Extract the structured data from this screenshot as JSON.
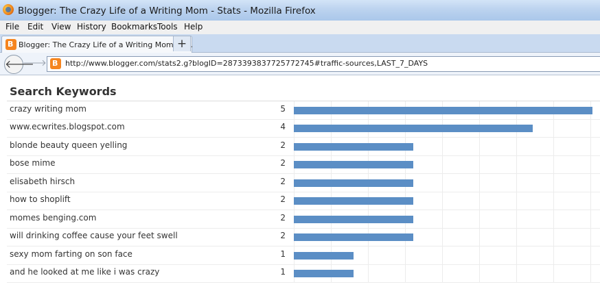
{
  "window": {
    "title": "Blogger: The Crazy Life of a Writing Mom - Stats - Mozilla Firefox"
  },
  "menu": {
    "items": [
      "File",
      "Edit",
      "View",
      "History",
      "Bookmarks",
      "Tools",
      "Help"
    ]
  },
  "tab": {
    "title": "Blogger: The Crazy Life of a Writing Mom - S...",
    "new_tab_label": "+"
  },
  "nav": {
    "url": "http://www.blogger.com/stats2.g?blogID=2873393837725772745#traffic-sources,LAST_7_DAYS",
    "back_label": "🡐",
    "forward_label": "🡒"
  },
  "section": {
    "title": "Search Keywords"
  },
  "keywords": {
    "max_count": 5,
    "bar_color": "#5b8ec5",
    "rows": [
      {
        "keyword": "crazy writing mom",
        "count": 5
      },
      {
        "keyword": "www.ecwrites.blogspot.com",
        "count": 4
      },
      {
        "keyword": "blonde beauty queen yelling",
        "count": 2
      },
      {
        "keyword": "bose mime",
        "count": 2
      },
      {
        "keyword": "elisabeth hirsch",
        "count": 2
      },
      {
        "keyword": "how to shoplift",
        "count": 2
      },
      {
        "keyword": "momes benging.com",
        "count": 2
      },
      {
        "keyword": "will drinking coffee cause your feet swell",
        "count": 2
      },
      {
        "keyword": "sexy mom farting on son face",
        "count": 1
      },
      {
        "keyword": "and he looked at me like i was crazy",
        "count": 1
      }
    ]
  }
}
